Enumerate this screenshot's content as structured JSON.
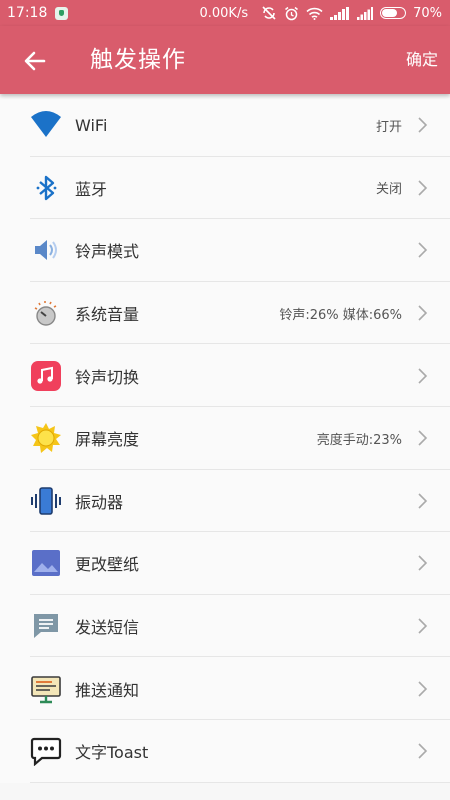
{
  "status_bar": {
    "time": "17:18",
    "network_speed": "0.00K/s",
    "network_type_top": "4G",
    "network_type_bottom": "1X",
    "battery_percent": "70%",
    "battery_level": 0.7
  },
  "toolbar": {
    "title": "触发操作",
    "confirm_label": "确定",
    "color": "#d95c6c"
  },
  "items": [
    {
      "label": "WiFi",
      "value": "打开",
      "icon": "wifi-icon"
    },
    {
      "label": "蓝牙",
      "value": "关闭",
      "icon": "bluetooth-icon"
    },
    {
      "label": "铃声模式",
      "value": "",
      "icon": "speaker-icon"
    },
    {
      "label": "系统音量",
      "value": "铃声:26% 媒体:66%",
      "icon": "volume-dial-icon"
    },
    {
      "label": "铃声切换",
      "value": "",
      "icon": "music-note-icon"
    },
    {
      "label": "屏幕亮度",
      "value": "亮度手动:23%",
      "icon": "sun-icon"
    },
    {
      "label": "振动器",
      "value": "",
      "icon": "vibrate-icon"
    },
    {
      "label": "更改壁纸",
      "value": "",
      "icon": "wallpaper-icon"
    },
    {
      "label": "发送短信",
      "value": "",
      "icon": "sms-icon"
    },
    {
      "label": "推送通知",
      "value": "",
      "icon": "notification-board-icon"
    },
    {
      "label": "文字Toast",
      "value": "",
      "icon": "chat-bubble-icon"
    }
  ]
}
